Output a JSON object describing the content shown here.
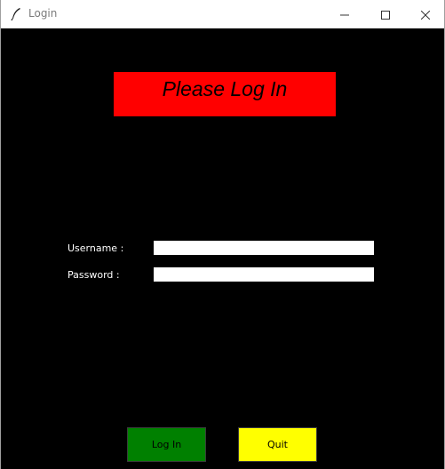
{
  "window": {
    "title": "Login",
    "app_icon": "feather-icon",
    "controls": {
      "minimize_icon": "minimize-icon",
      "maximize_icon": "maximize-icon",
      "close_icon": "close-icon"
    }
  },
  "header": {
    "text": "Please Log In",
    "background": "#ff0000"
  },
  "form": {
    "username_label": "Username :",
    "username_value": "",
    "password_label": "Password :",
    "password_value": ""
  },
  "buttons": {
    "login_label": "Log In",
    "login_color": "#008000",
    "quit_label": "Quit",
    "quit_color": "#ffff00"
  },
  "colors": {
    "background": "#000000",
    "label_text": "#ffffff"
  }
}
